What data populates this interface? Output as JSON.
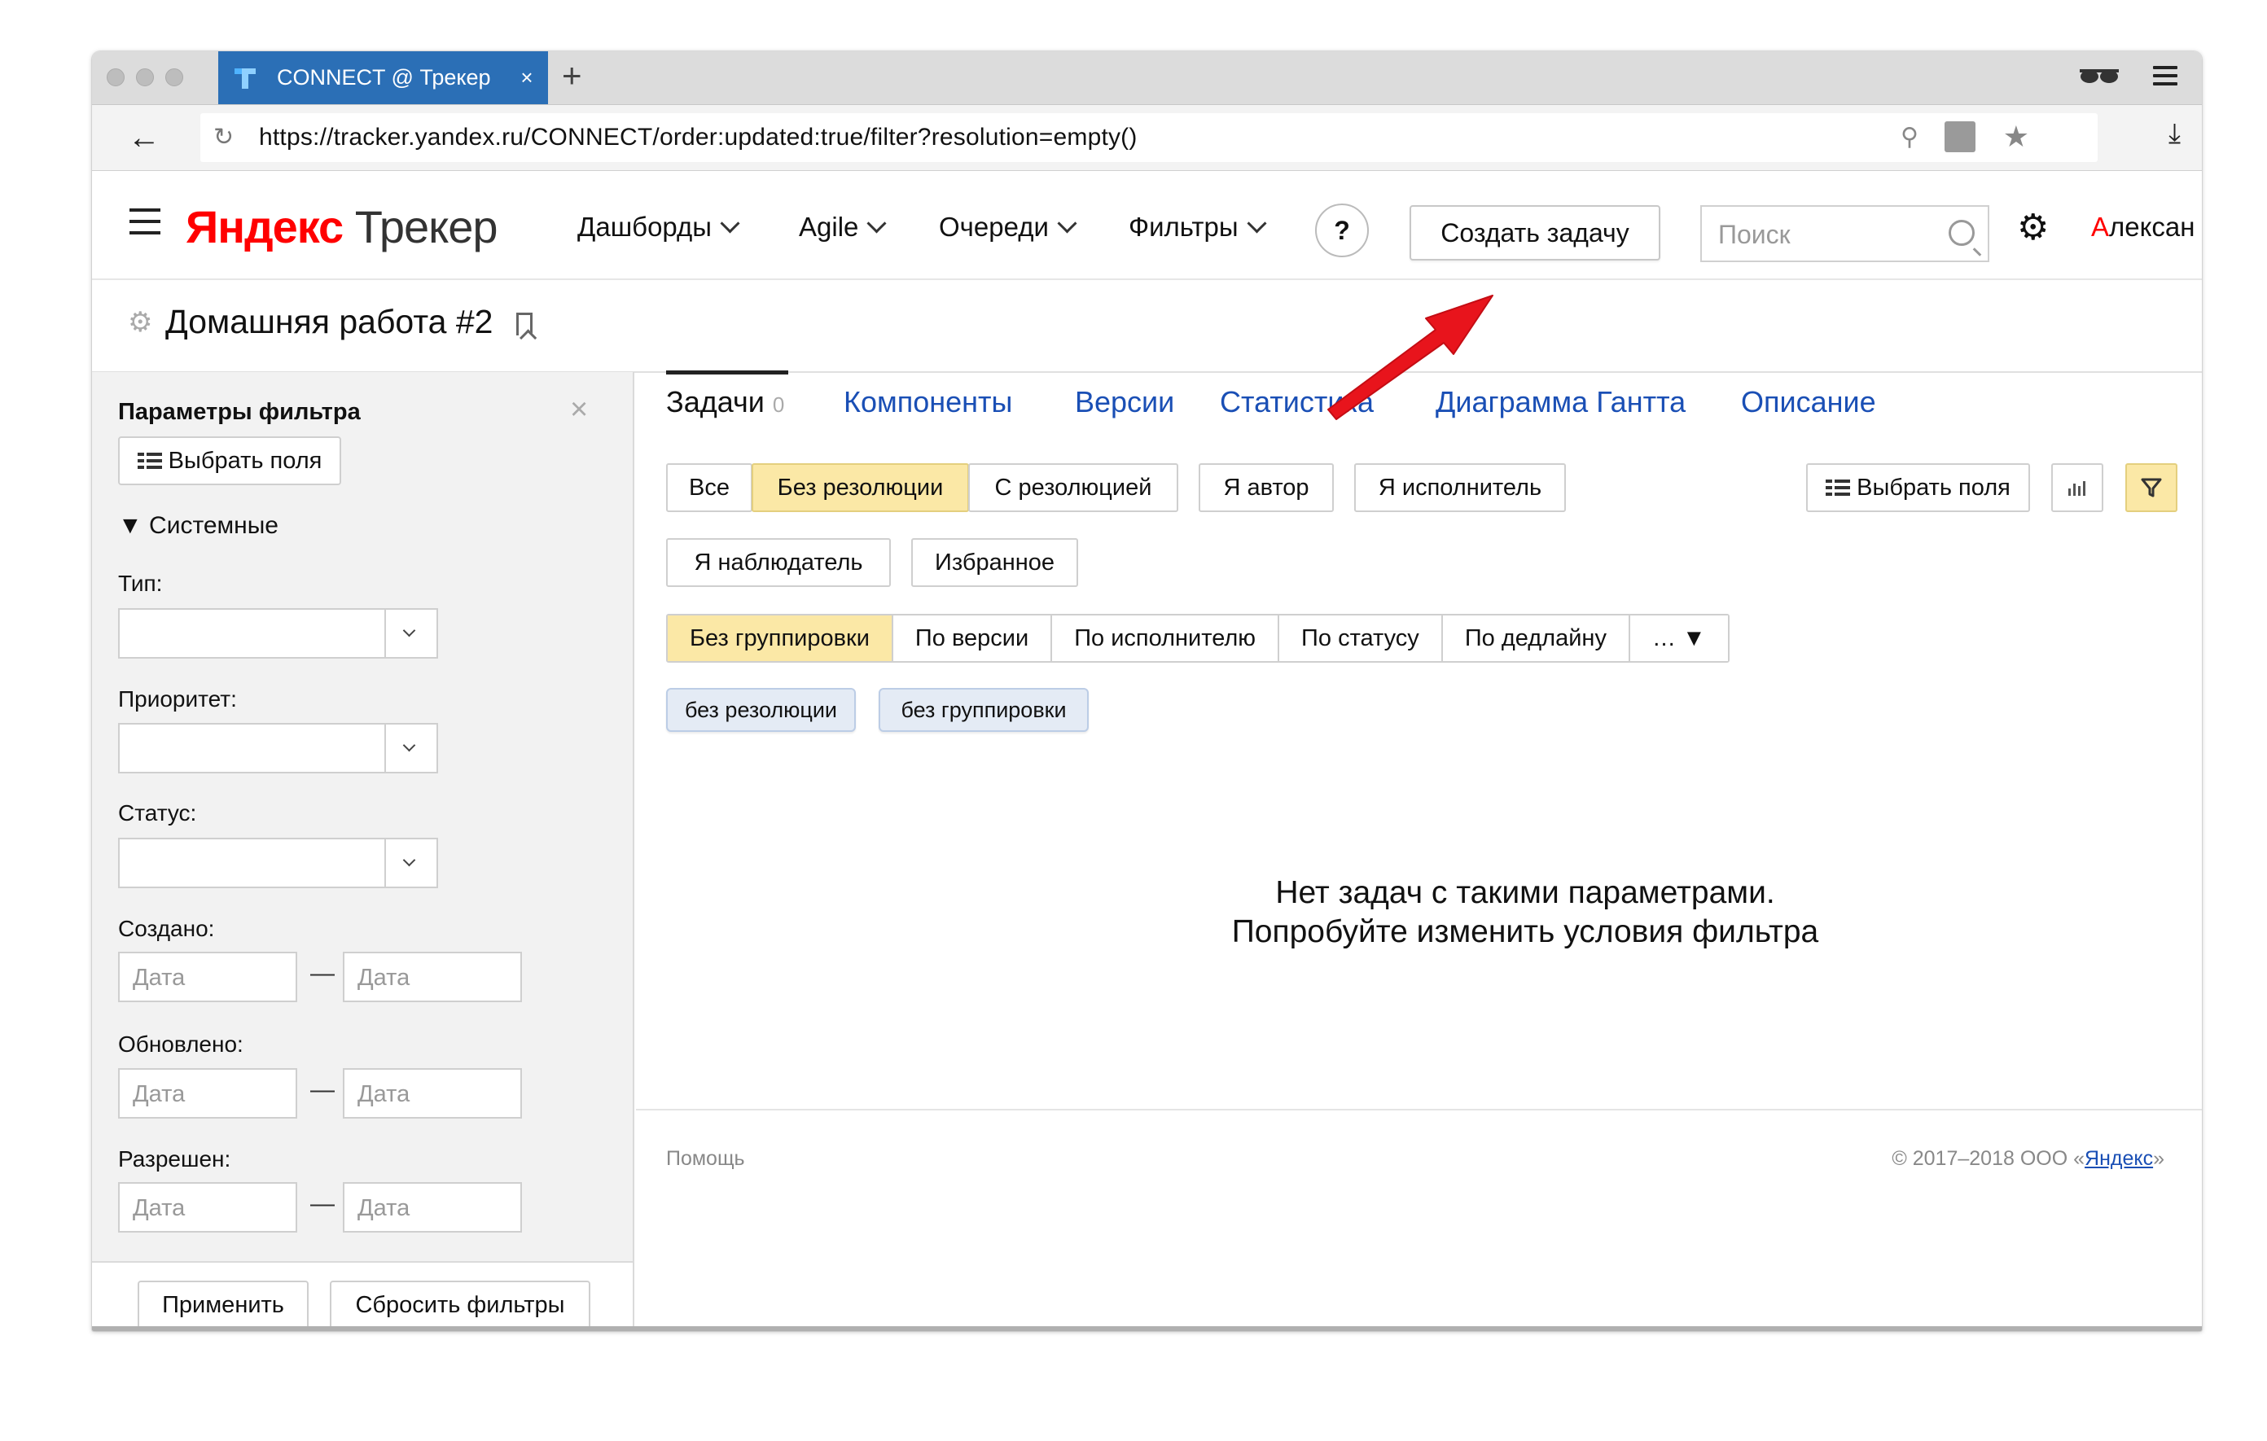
{
  "browser": {
    "tab_title": "CONNECT @ Трекер",
    "tab_close": "×",
    "new_tab": "+",
    "url": "https://tracker.yandex.ru/CONNECT/order:updated:true/filter?resolution=empty()"
  },
  "header": {
    "logo_yandex": "Яндекс",
    "logo_tracker": " Трекер",
    "nav": [
      "Дашборды",
      "Agile",
      "Очереди",
      "Фильтры"
    ],
    "help": "?",
    "create_task": "Создать задачу",
    "search_placeholder": "Поиск",
    "user_first_letter": "А",
    "user_rest": "лексан"
  },
  "page": {
    "title": "Домашняя работа #2"
  },
  "sidebar": {
    "title": "Параметры фильтра",
    "close": "×",
    "choose_fields": "Выбрать поля",
    "section": "▼ Системные",
    "type_label": "Тип:",
    "priority_label": "Приоритет:",
    "status_label": "Статус:",
    "created_label": "Создано:",
    "updated_label": "Обновлено:",
    "resolved_label": "Разрешен:",
    "date_placeholder": "Дата",
    "dash": "—",
    "apply": "Применить",
    "reset": "Сбросить фильтры"
  },
  "main": {
    "tabs": {
      "tasks": "Задачи",
      "tasks_count": "0",
      "components": "Компоненты",
      "versions": "Версии",
      "stats": "Статистика",
      "gantt": "Диаграмма Гантта",
      "description": "Описание"
    },
    "filters": {
      "all": "Все",
      "no_resolution": "Без резолюции",
      "with_resolution": "С резолюцией",
      "i_author": "Я автор",
      "i_assignee": "Я исполнитель",
      "i_watcher": "Я наблюдатель",
      "favorites": "Избранное",
      "choose_fields": "Выбрать поля"
    },
    "grouping": {
      "none": "Без группировки",
      "by_version": "По версии",
      "by_assignee": "По исполнителю",
      "by_status": "По статусу",
      "by_deadline": "По дедлайну",
      "more": "… ▼"
    },
    "chips": [
      "без резолюции",
      "без группировки"
    ],
    "empty_line1": "Нет задач с такими параметрами.",
    "empty_line2": "Попробуйте изменить условия фильтра"
  },
  "footer": {
    "help": "Помощь",
    "copyright_prefix": "© 2017–2018  ООО «",
    "copyright_link": "Яндекс",
    "copyright_suffix": "»"
  },
  "colors": {
    "tab_blue": "#2b6fb6",
    "selected_yellow": "#fbe8a6",
    "link_blue": "#1a4fb5",
    "brand_red": "#ff0000",
    "arrow_red": "#e8141c"
  }
}
